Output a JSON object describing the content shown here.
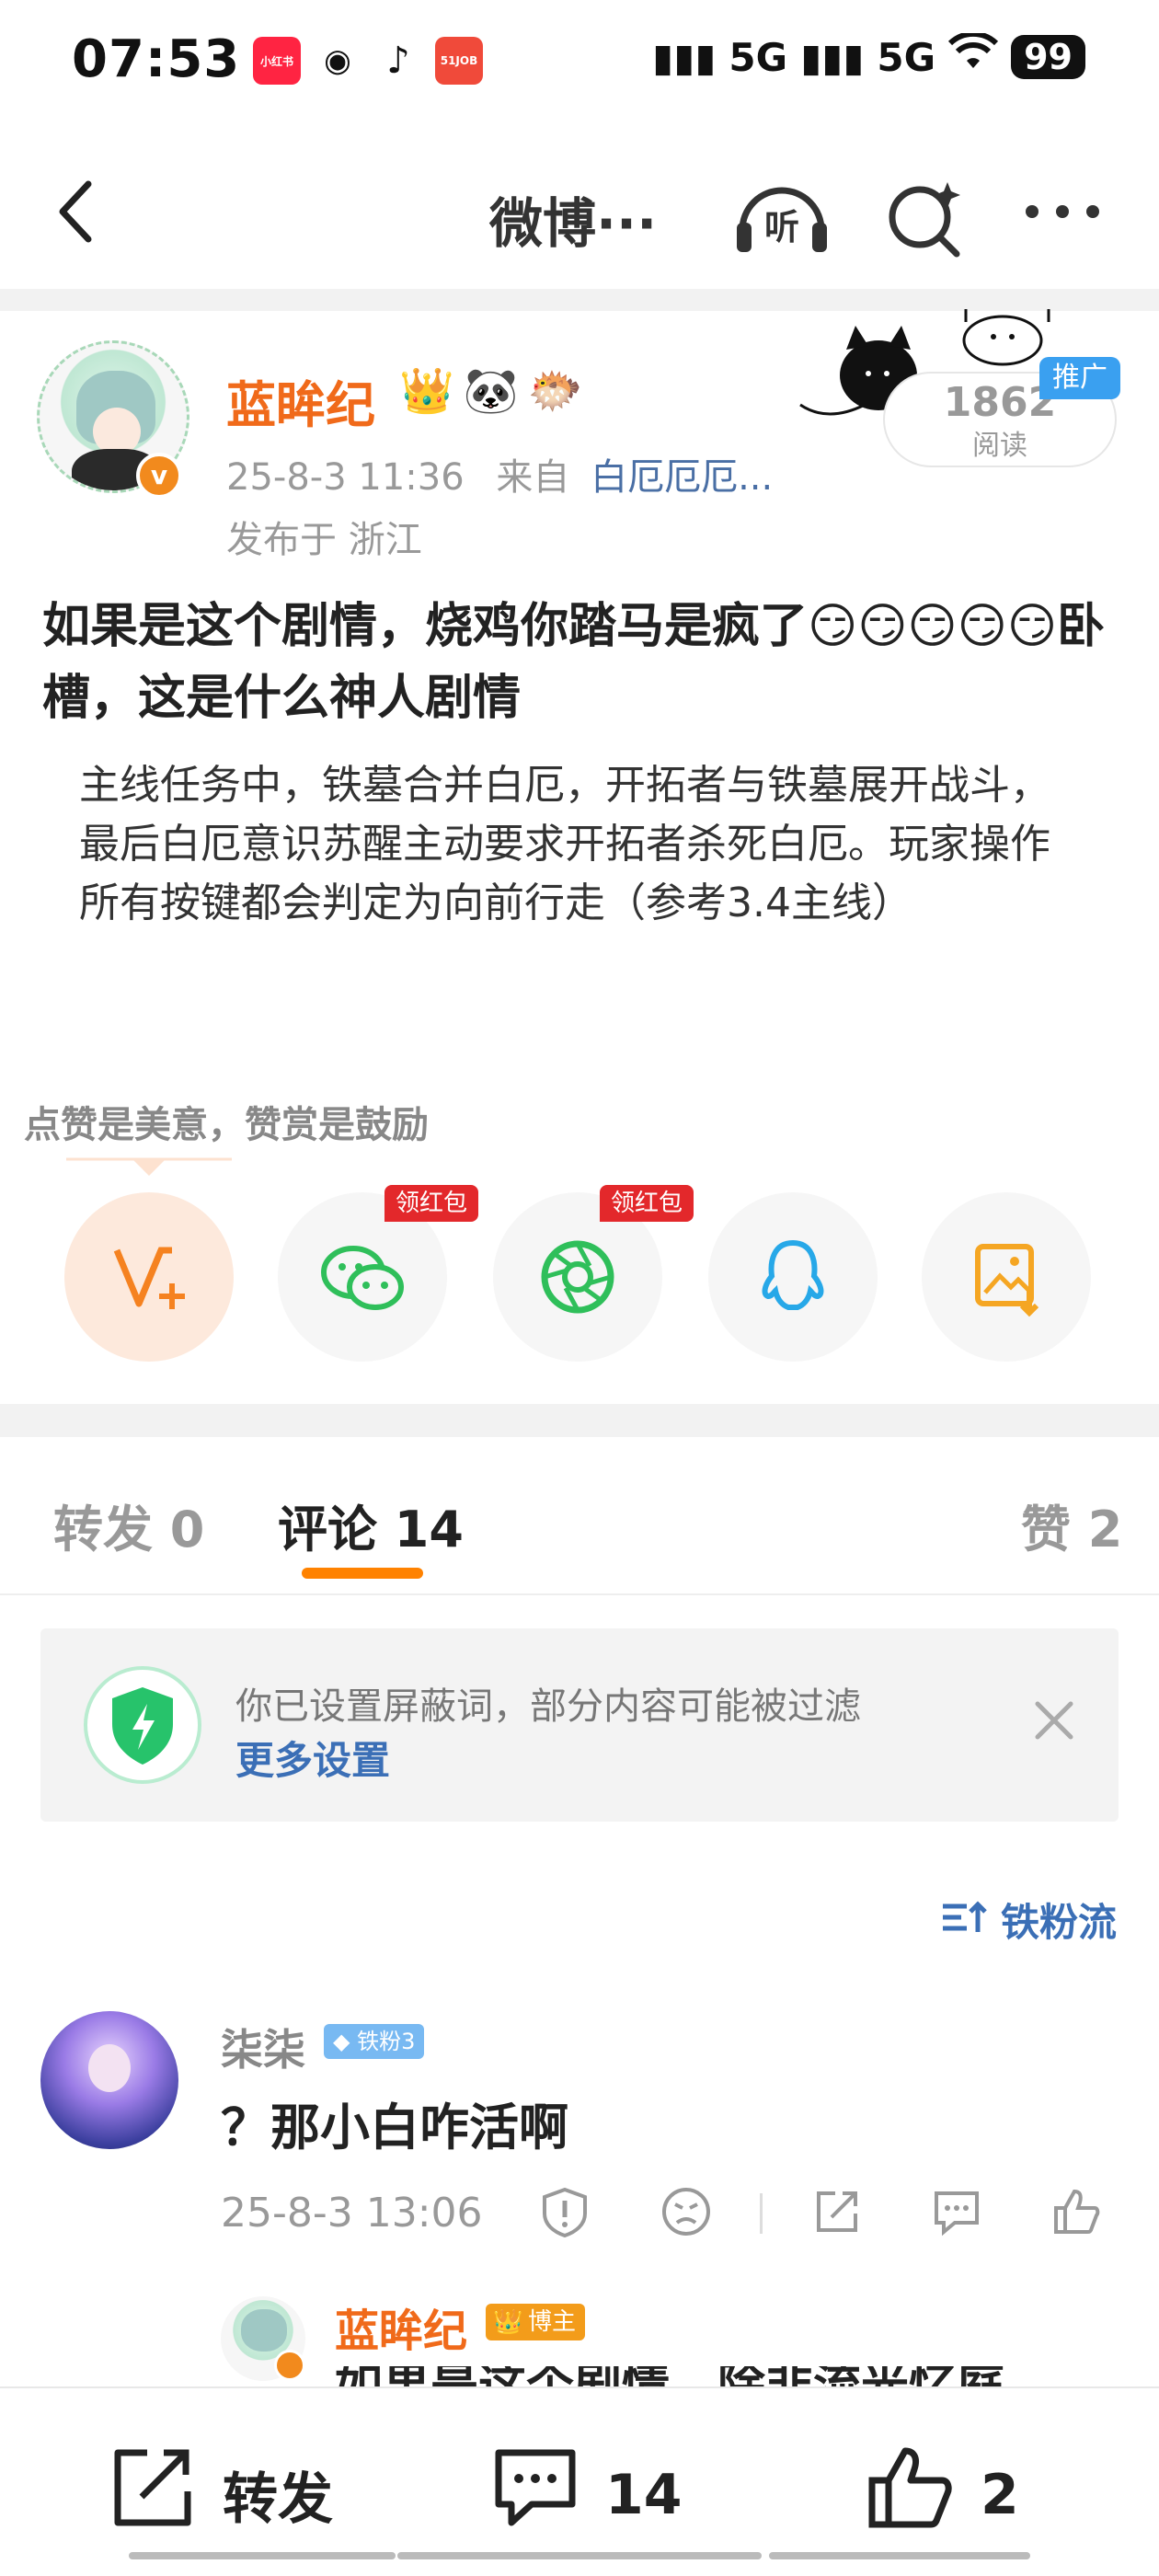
{
  "status_bar": {
    "time": "07:53",
    "apps": [
      "小红书",
      "微博",
      "抖音",
      "51JOB"
    ],
    "network_1": "5G",
    "network_2": "5G",
    "battery": "99"
  },
  "nav": {
    "title": "微博···",
    "listen_label": "听"
  },
  "post": {
    "author": "蓝眸纪",
    "author_emojis": [
      "👑",
      "🐼",
      "🐡"
    ],
    "time": "25-8-3 11:36",
    "from_prefix": "来自",
    "source": "白厄厄厄...",
    "location": "发布于 浙江",
    "read_count": "1862",
    "read_label": "阅读",
    "promo_tag": "推广",
    "title": "如果是这个剧情，烧鸡你踏马是疯了😏😏😏😏😏卧槽，这是什么神人剧情",
    "body": "主线任务中，铁墓合并白厄，开拓者与铁墓展开战斗，最后白厄意识苏醒主动要求开拓者杀死白厄。玩家操作所有按键都会判定为向前行走（参考3.4主线）"
  },
  "reward": {
    "text": "点赞是美意，赞赏是鼓励",
    "redpack_label": "领红包"
  },
  "tabs": {
    "repost": "转发 0",
    "comment": "评论 14",
    "like": "赞 2"
  },
  "notice": {
    "text": "你已设置屏蔽词，部分内容可能被过滤",
    "link": "更多设置"
  },
  "sort_label": "铁粉流",
  "comment": {
    "name": "柒柒",
    "badge": "铁粉3",
    "text": "？那小白咋活啊",
    "time": "25-8-3 13:06"
  },
  "reply": {
    "name": "蓝眸纪",
    "badge": "博主",
    "text": "如果是这个剧情，除非流光忆庭"
  },
  "bottom_bar": {
    "repost": "转发",
    "comment_count": "14",
    "like_count": "2"
  },
  "colors": {
    "accent_orange": "#ff8200",
    "author_orange": "#f06a1a",
    "link_blue": "#3b6fb6",
    "promo_blue": "#3aa0f0",
    "redpack_red": "#e3282b"
  }
}
